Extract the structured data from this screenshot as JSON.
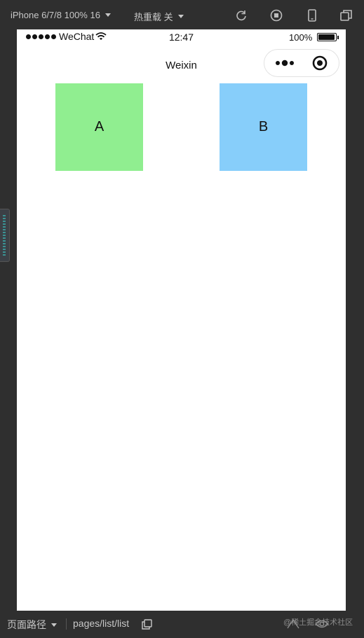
{
  "toolbar": {
    "device": "iPhone 6/7/8 100% 16",
    "hot_reload": "热重载 关",
    "icons": [
      "refresh-icon",
      "stop-icon",
      "phone-icon",
      "window-icon"
    ]
  },
  "status_bar": {
    "carrier": "WeChat",
    "time": "12:47",
    "battery": "100%"
  },
  "nav_bar": {
    "title": "Weixin"
  },
  "boxes": [
    {
      "label": "A",
      "color": "#90ee90"
    },
    {
      "label": "B",
      "color": "#87cefa"
    }
  ],
  "bottom_bar": {
    "path_label": "页面路径",
    "path": "pages/list/list",
    "watermark": "@稀土掘金技术社区"
  }
}
